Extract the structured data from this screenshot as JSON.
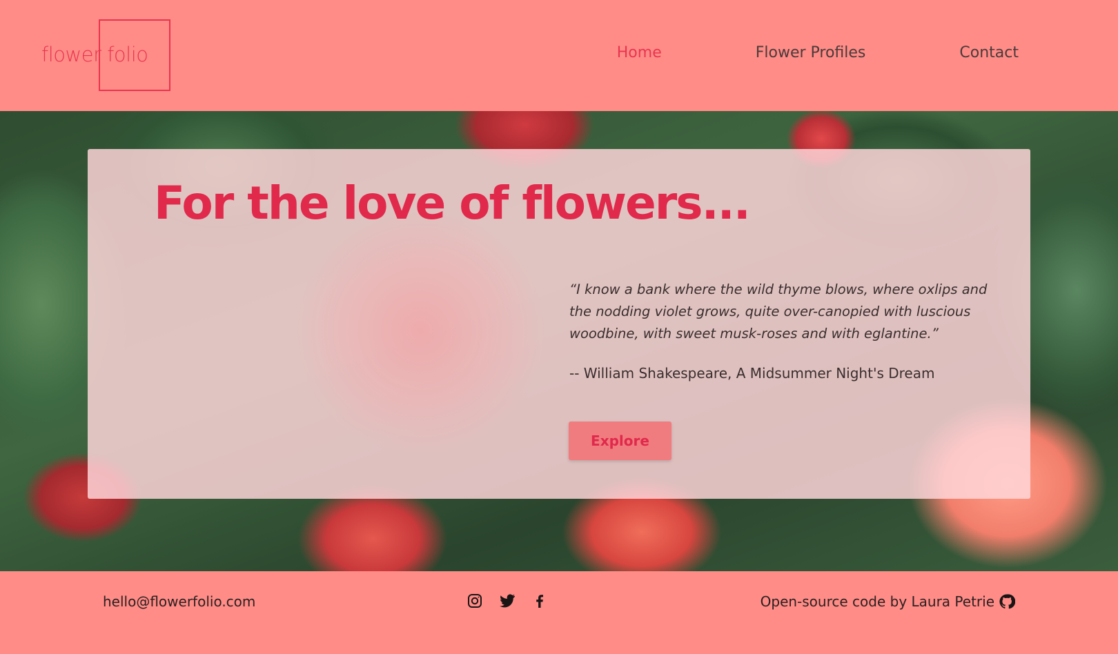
{
  "brand": {
    "logo_text": "flower folio"
  },
  "nav": {
    "items": [
      {
        "label": "Home",
        "active": true
      },
      {
        "label": "Flower Profiles",
        "active": false
      },
      {
        "label": "Contact",
        "active": false
      }
    ]
  },
  "hero": {
    "title": "For the love of flowers...",
    "quote": "“I know a bank where the wild thyme blows, where oxlips and the nodding violet grows, quite over-canopied with luscious woodbine, with sweet musk-roses and with eglantine.”",
    "attribution": "-- William Shakespeare, A Midsummer Night's Dream",
    "cta_label": "Explore"
  },
  "footer": {
    "email": "hello@flowerfolio.com",
    "social_icons": [
      "instagram-icon",
      "twitter-icon",
      "facebook-icon"
    ],
    "credit": "Open-source code by Laura Petrie",
    "credit_icon": "github-icon"
  },
  "colors": {
    "primary_bg": "#ff8c87",
    "accent": "#e0294b",
    "card_bg": "#ffd6da",
    "text_dark": "#3a2d2d"
  }
}
